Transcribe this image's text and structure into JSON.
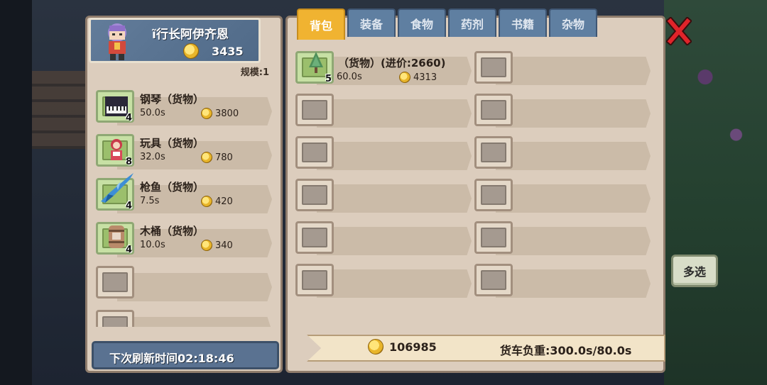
{
  "npc": {
    "name": "ĩ行长阿伊齐恩",
    "gold": "3435",
    "scale_label": "规模:1"
  },
  "shop_items": [
    {
      "name": "钢琴（货物）",
      "qty": "4",
      "time": "50.0s",
      "price": "3800",
      "icon": "piano-icon"
    },
    {
      "name": "玩具（货物）",
      "qty": "8",
      "time": "32.0s",
      "price": "780",
      "icon": "toy-doll-icon"
    },
    {
      "name": "枪鱼（货物）",
      "qty": "4",
      "time": "7.5s",
      "price": "420",
      "icon": "swordfish-icon"
    },
    {
      "name": "木桶（货物）",
      "qty": "4",
      "time": "10.0s",
      "price": "340",
      "icon": "barrel-icon"
    }
  ],
  "refresh_label": "下次刷新时间02:18:46",
  "tabs": [
    "背包",
    "装备",
    "食物",
    "药剂",
    "书籍",
    "杂物"
  ],
  "active_tab": "背包",
  "bag_item": {
    "name": "（货物）(进价:2660)",
    "qty": "5",
    "time": "60.0s",
    "price": "4313",
    "icon": "tree-icon"
  },
  "footer": {
    "gold": "106985",
    "load_label": "货车负重:300.0s/80.0s"
  },
  "buttons": {
    "multi_select": "多选"
  }
}
